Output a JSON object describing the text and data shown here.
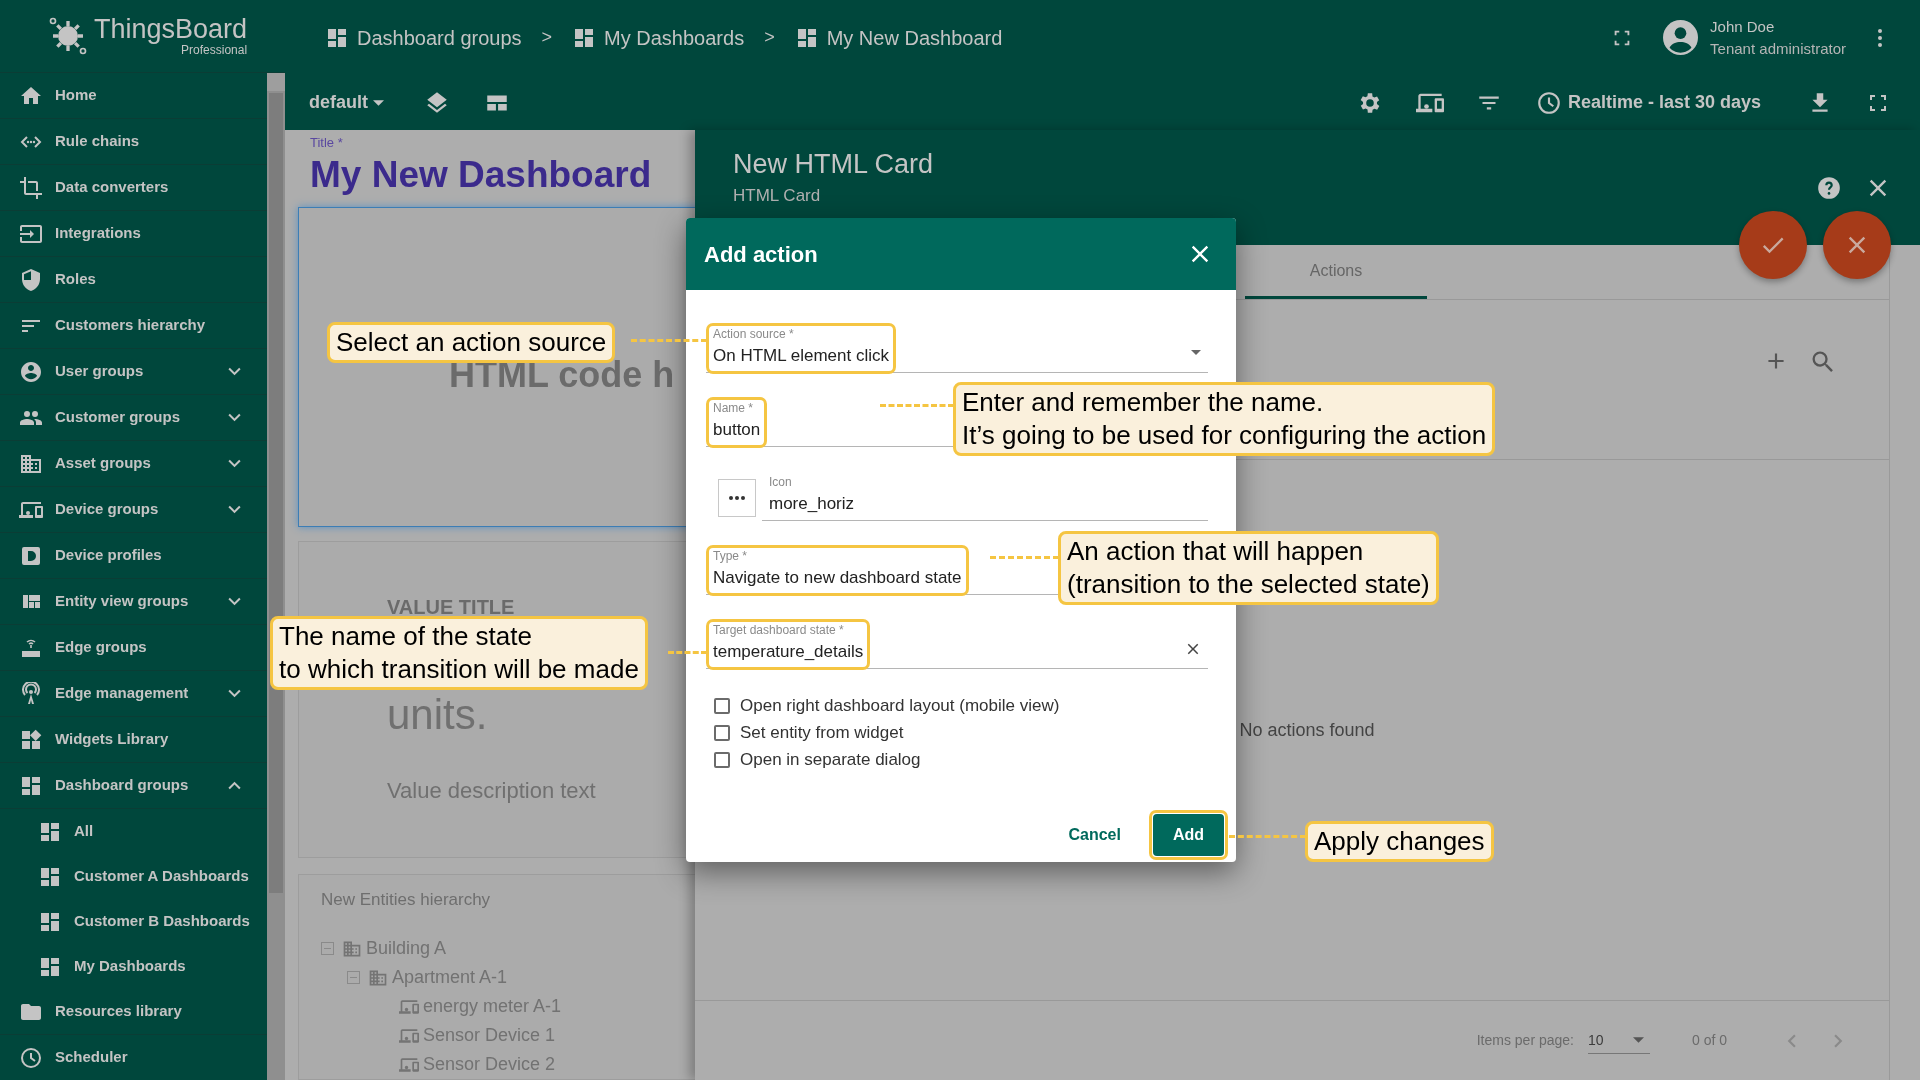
{
  "app": {
    "brand": "ThingsBoard",
    "edition": "Professional"
  },
  "breadcrumbs": [
    {
      "label": "Dashboard groups",
      "separator": ">"
    },
    {
      "label": "My Dashboards",
      "separator": ">"
    },
    {
      "label": "My New Dashboard"
    }
  ],
  "user": {
    "name": "John Doe",
    "role": "Tenant administrator"
  },
  "sidebar": {
    "items": [
      {
        "label": "Home",
        "kind": "link"
      },
      {
        "label": "Rule chains",
        "kind": "link"
      },
      {
        "label": "Data converters",
        "kind": "link"
      },
      {
        "label": "Integrations",
        "kind": "link"
      },
      {
        "label": "Roles",
        "kind": "link"
      },
      {
        "label": "Customers hierarchy",
        "kind": "link"
      },
      {
        "label": "User groups",
        "kind": "group",
        "expanded": false
      },
      {
        "label": "Customer groups",
        "kind": "group",
        "expanded": false
      },
      {
        "label": "Asset groups",
        "kind": "group",
        "expanded": false
      },
      {
        "label": "Device groups",
        "kind": "group",
        "expanded": false
      },
      {
        "label": "Device profiles",
        "kind": "link"
      },
      {
        "label": "Entity view groups",
        "kind": "group",
        "expanded": false
      },
      {
        "label": "Edge groups",
        "kind": "link"
      },
      {
        "label": "Edge management",
        "kind": "group",
        "expanded": false
      },
      {
        "label": "Widgets Library",
        "kind": "link"
      },
      {
        "label": "Dashboard groups",
        "kind": "group",
        "expanded": true,
        "children": [
          {
            "label": "All"
          },
          {
            "label": "Customer A Dashboards"
          },
          {
            "label": "Customer B Dashboards"
          },
          {
            "label": "My Dashboards"
          }
        ]
      },
      {
        "label": "Resources library",
        "kind": "link"
      },
      {
        "label": "Scheduler",
        "kind": "link"
      }
    ]
  },
  "toolbar": {
    "state": "default",
    "timewindow": "Realtime - last 30 days"
  },
  "dashboard": {
    "title_label": "Title *",
    "title": "My New Dashboard",
    "html_card": {
      "text": "HTML code h"
    },
    "value_card": {
      "title": "VALUE TITLE",
      "units": "units.",
      "description": "Value description text"
    },
    "hierarchy": {
      "title": "New Entities hierarchy",
      "tree": [
        {
          "label": "Building A",
          "kind": "asset",
          "expanded": true,
          "children": [
            {
              "label": "Apartment A-1",
              "kind": "asset",
              "expanded": true,
              "children": [
                {
                  "label": "energy meter A-1",
                  "kind": "device"
                },
                {
                  "label": "Sensor Device 1",
                  "kind": "device"
                },
                {
                  "label": "Sensor Device 2",
                  "kind": "device"
                }
              ]
            }
          ]
        }
      ]
    }
  },
  "widget_editor": {
    "title": "New HTML Card",
    "subtitle": "HTML Card",
    "tabs": [
      {
        "label": "Actions",
        "selected": true
      }
    ],
    "empty_text": "No actions found",
    "pagination": {
      "label": "Items per page:",
      "page_size": "10",
      "range": "0 of 0"
    }
  },
  "dialog": {
    "title": "Add action",
    "fields": [
      {
        "kind": "select",
        "label": "Action source *",
        "value": "On HTML element click",
        "highlighted": true
      },
      {
        "kind": "text",
        "label": "Name *",
        "value": "button",
        "highlighted": true
      },
      {
        "kind": "icon",
        "label": "Icon",
        "value": "more_horiz",
        "highlighted": false
      },
      {
        "kind": "text",
        "label": "Type *",
        "value": "Navigate to new dashboard state",
        "highlighted": true
      },
      {
        "kind": "clearable",
        "label": "Target dashboard state *",
        "value": "temperature_details",
        "highlighted": true
      }
    ],
    "checkboxes": [
      {
        "label": "Open right dashboard layout (mobile view)",
        "checked": false
      },
      {
        "label": "Set entity from widget",
        "checked": false
      },
      {
        "label": "Open in separate dialog",
        "checked": false
      }
    ],
    "buttons": [
      {
        "label": "Cancel",
        "kind": "text",
        "highlighted": false
      },
      {
        "label": "Add",
        "kind": "primary",
        "highlighted": true
      }
    ]
  },
  "callouts": [
    {
      "text": "Select an action source"
    },
    {
      "text": "Enter and remember the name.\nIt’s going to be used for configuring the action"
    },
    {
      "text": "An action that will happen\n(transition to the selected state)"
    },
    {
      "text": "The name of the state\nto which transition will be made"
    },
    {
      "text": "Apply changes"
    }
  ]
}
